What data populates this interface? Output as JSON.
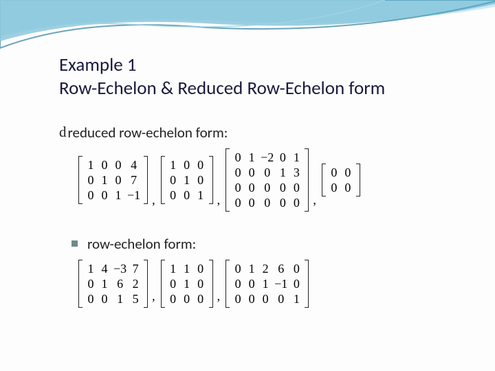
{
  "title": {
    "line1": "Example 1",
    "line2": "Row-Echelon & Reduced Row-Echelon form"
  },
  "section1": {
    "label": "reduced row-echelon form:",
    "bullet": "d",
    "matrices": [
      {
        "rows": 3,
        "cols": 4,
        "values": [
          "1",
          "0",
          "0",
          "4",
          "0",
          "1",
          "0",
          "7",
          "0",
          "0",
          "1",
          "−1"
        ]
      },
      {
        "rows": 3,
        "cols": 3,
        "values": [
          "1",
          "0",
          "0",
          "0",
          "1",
          "0",
          "0",
          "0",
          "1"
        ]
      },
      {
        "rows": 4,
        "cols": 5,
        "values": [
          "0",
          "1",
          "−2",
          "0",
          "1",
          "0",
          "0",
          "0",
          "1",
          "3",
          "0",
          "0",
          "0",
          "0",
          "0",
          "0",
          "0",
          "0",
          "0",
          "0"
        ]
      },
      {
        "rows": 2,
        "cols": 2,
        "values": [
          "0",
          "0",
          "0",
          "0"
        ]
      }
    ]
  },
  "section2": {
    "label": "row-echelon form:",
    "matrices": [
      {
        "rows": 3,
        "cols": 4,
        "values": [
          "1",
          "4",
          "−3",
          "7",
          "0",
          "1",
          "6",
          "2",
          "0",
          "0",
          "1",
          "5"
        ]
      },
      {
        "rows": 3,
        "cols": 3,
        "values": [
          "1",
          "1",
          "0",
          "0",
          "1",
          "0",
          "0",
          "0",
          "0"
        ]
      },
      {
        "rows": 3,
        "cols": 5,
        "values": [
          "0",
          "1",
          "2",
          "6",
          "0",
          "0",
          "0",
          "1",
          "−1",
          "0",
          "0",
          "0",
          "0",
          "0",
          "1"
        ]
      }
    ]
  },
  "comma": ","
}
